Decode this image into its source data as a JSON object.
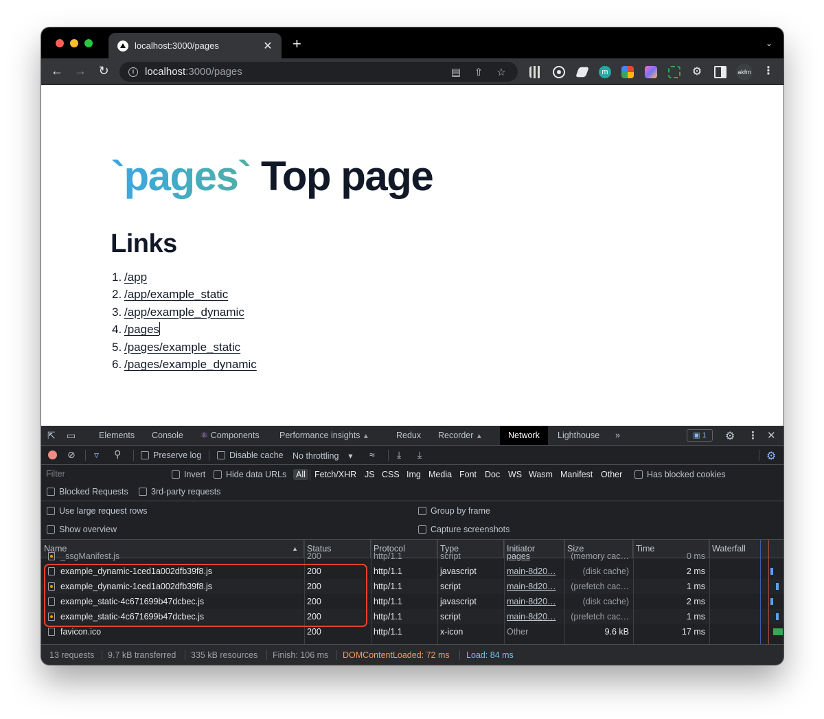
{
  "browser": {
    "tab_title": "localhost:3000/pages",
    "tab_close": "✕",
    "new_tab": "+",
    "url_host": "localhost",
    "url_rest": ":3000/pages",
    "avatar_text": "akfm",
    "ext_m": "m"
  },
  "page": {
    "hero_code": "`pages`",
    "hero_text": " Top page",
    "links_title": "Links",
    "links": [
      {
        "num": "1.",
        "label": "/app"
      },
      {
        "num": "2.",
        "label": "/app/example_static"
      },
      {
        "num": "3.",
        "label": "/app/example_dynamic"
      },
      {
        "num": "4.",
        "label": "/pages"
      },
      {
        "num": "5.",
        "label": "/pages/example_static"
      },
      {
        "num": "6.",
        "label": "/pages/example_dynamic"
      }
    ]
  },
  "devtools": {
    "tabs": [
      "Elements",
      "Console",
      "Components",
      "Performance insights",
      "Redux",
      "Recorder",
      "Network",
      "Lighthouse"
    ],
    "issues_count": "1",
    "toolbar": {
      "preserve_log": "Preserve log",
      "disable_cache": "Disable cache",
      "throttling": "No throttling"
    },
    "filter": {
      "placeholder": "Filter",
      "invert": "Invert",
      "hide_data_urls": "Hide data URLs",
      "types": [
        "All",
        "Fetch/XHR",
        "JS",
        "CSS",
        "Img",
        "Media",
        "Font",
        "Doc",
        "WS",
        "Wasm",
        "Manifest",
        "Other"
      ],
      "has_blocked_cookies": "Has blocked cookies",
      "blocked_requests": "Blocked Requests",
      "third_party": "3rd-party requests"
    },
    "settings": {
      "large_rows": "Use large request rows",
      "group_by_frame": "Group by frame",
      "show_overview": "Show overview",
      "capture_screenshots": "Capture screenshots"
    },
    "columns": [
      "Name",
      "Status",
      "Protocol",
      "Type",
      "Initiator",
      "Size",
      "Time",
      "Waterfall"
    ],
    "partial_row": {
      "name": "_ssgManifest.js",
      "status": "200",
      "protocol": "http/1.1",
      "type": "script",
      "initiator": "pages",
      "size": "(memory cac…",
      "time": "0 ms"
    },
    "rows": [
      {
        "name": "example_dynamic-1ced1a002dfb39f8.js",
        "status": "200",
        "protocol": "http/1.1",
        "type": "javascript",
        "initiator": "main-8d20…",
        "size": "(disk cache)",
        "time": "2 ms",
        "icon": "file"
      },
      {
        "name": "example_dynamic-1ced1a002dfb39f8.js",
        "status": "200",
        "protocol": "http/1.1",
        "type": "script",
        "initiator": "main-8d20…",
        "size": "(prefetch cac…",
        "time": "1 ms",
        "icon": "js"
      },
      {
        "name": "example_static-4c671699b47dcbec.js",
        "status": "200",
        "protocol": "http/1.1",
        "type": "javascript",
        "initiator": "main-8d20…",
        "size": "(disk cache)",
        "time": "2 ms",
        "icon": "file"
      },
      {
        "name": "example_static-4c671699b47dcbec.js",
        "status": "200",
        "protocol": "http/1.1",
        "type": "script",
        "initiator": "main-8d20…",
        "size": "(prefetch cac…",
        "time": "1 ms",
        "icon": "js"
      },
      {
        "name": "favicon.ico",
        "status": "200",
        "protocol": "http/1.1",
        "type": "x-icon",
        "initiator": "Other",
        "size": "9.6 kB",
        "time": "17 ms",
        "icon": "file"
      }
    ],
    "status": {
      "requests": "13 requests",
      "transferred": "9.7 kB transferred",
      "resources": "335 kB resources",
      "finish": "Finish: 106 ms",
      "dom_loaded": "DOMContentLoaded: 72 ms",
      "load": "Load: 84 ms"
    }
  },
  "colors": {
    "highlight": "#e1452b",
    "dom_loaded": "#f29b66",
    "load": "#73c3e7",
    "gradient_start": "#3ba6e5",
    "gradient_end": "#4fb0a3"
  },
  "icons": [
    "back-arrow-icon",
    "forward-arrow-icon",
    "reload-icon",
    "info-icon",
    "translate-icon",
    "share-icon",
    "star-icon",
    "puzzle-icon",
    "kebab-icon",
    "inspect-icon",
    "device-icon",
    "record-icon",
    "clear-icon",
    "filter-icon",
    "search-icon",
    "wifi-icon",
    "upload-icon",
    "download-icon",
    "gear-icon",
    "close-icon"
  ]
}
